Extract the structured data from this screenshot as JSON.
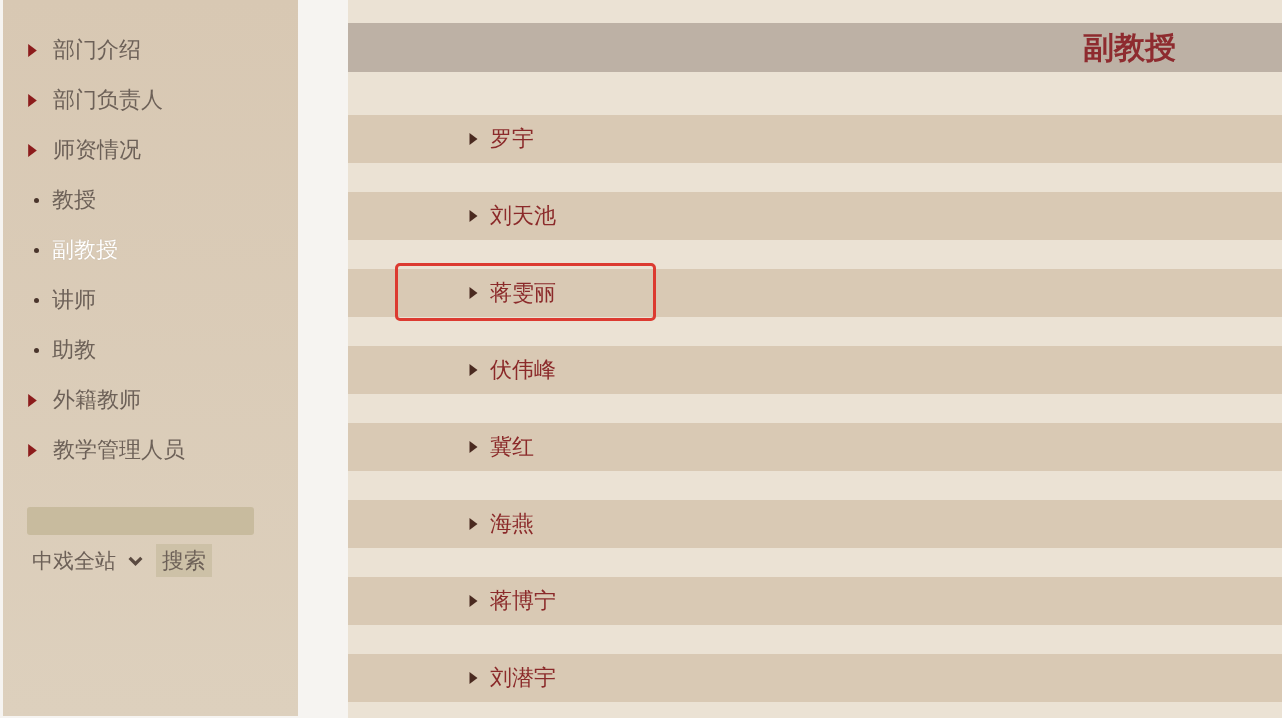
{
  "sidebar": {
    "items": [
      {
        "label": "部门介绍",
        "selected": false
      },
      {
        "label": "部门负责人",
        "selected": false
      },
      {
        "label": "师资情况",
        "selected": false,
        "children": [
          {
            "label": "教授",
            "selected": false
          },
          {
            "label": "副教授",
            "selected": true
          },
          {
            "label": "讲师",
            "selected": false
          },
          {
            "label": "助教",
            "selected": false
          }
        ]
      },
      {
        "label": "外籍教师",
        "selected": false
      },
      {
        "label": "教学管理人员",
        "selected": false
      }
    ],
    "search": {
      "scope": "中戏全站",
      "button": "搜索"
    }
  },
  "content": {
    "heading": "副教授",
    "items": [
      {
        "name": "罗宇",
        "outlined": false
      },
      {
        "name": "刘天池",
        "outlined": false
      },
      {
        "name": "蒋雯丽",
        "outlined": true
      },
      {
        "name": "伏伟峰",
        "outlined": false
      },
      {
        "name": "冀红",
        "outlined": false
      },
      {
        "name": "海燕",
        "outlined": false
      },
      {
        "name": "蒋博宁",
        "outlined": false
      },
      {
        "name": "刘潜宇",
        "outlined": false
      }
    ]
  }
}
